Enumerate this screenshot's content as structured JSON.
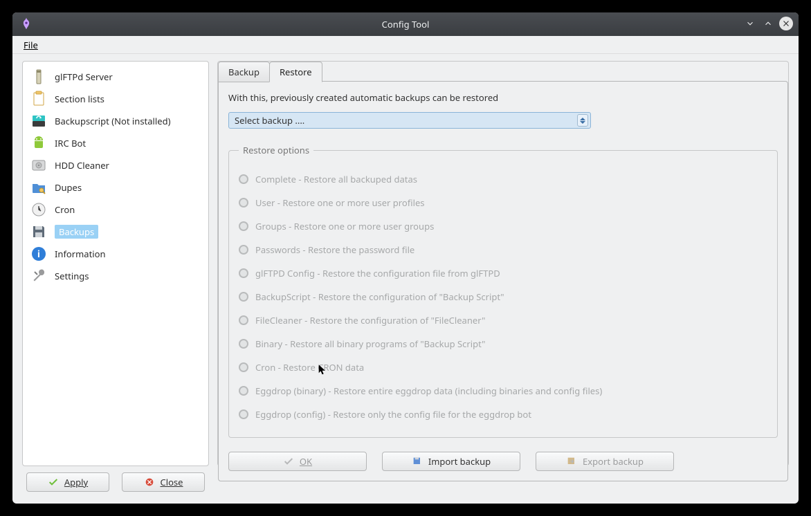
{
  "window": {
    "title": "Config Tool"
  },
  "menu": {
    "file": "File"
  },
  "sidebar": {
    "items": [
      {
        "label": "glFTPd Server"
      },
      {
        "label": "Section lists"
      },
      {
        "label": "Backupscript (Not installed)"
      },
      {
        "label": "IRC Bot"
      },
      {
        "label": "HDD Cleaner"
      },
      {
        "label": "Dupes"
      },
      {
        "label": "Cron"
      },
      {
        "label": "Backups"
      },
      {
        "label": "Information"
      },
      {
        "label": "Settings"
      }
    ]
  },
  "tabs": {
    "backup": "Backup",
    "restore": "Restore"
  },
  "content": {
    "description": "With this, previously created automatic backups can be restored",
    "select_label": "Select backup ....",
    "fieldset_title": "Restore options",
    "options": [
      "Complete - Restore all backuped datas",
      "User - Restore one or more user profiles",
      "Groups - Restore one or more user groups",
      "Passwords - Restore the password file",
      "glFTPD Config - Restore the configuration file from glFTPD",
      "BackupScript - Restore the configuration of \"Backup Script\"",
      "FileCleaner - Restore the configuration of \"FileCleaner\"",
      "Binary - Restore all binary programs of \"Backup Script\"",
      "Cron - Restore CRON data",
      "Eggdrop (binary) - Restore  entire eggdrop data (including binaries and config files)",
      "Eggdrop (config) - Restore only the config file for the eggdrop bot"
    ],
    "buttons": {
      "ok": "OK",
      "import": "Import backup",
      "export": "Export backup"
    }
  },
  "footer": {
    "apply": "Apply",
    "close": "Close"
  },
  "colors": {
    "accent": "#9ad1f5",
    "border": "#c6c7c8",
    "panel": "#eff0f1"
  }
}
